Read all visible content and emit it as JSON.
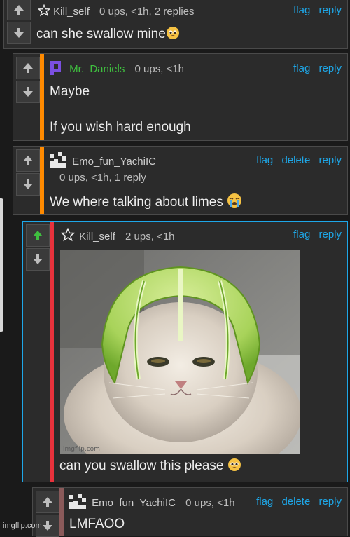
{
  "comments": [
    {
      "user": "Kill_self",
      "meta": "0 ups, <1h, 2 replies",
      "actions": [
        "flag",
        "reply"
      ],
      "text": "can she swallow mine"
    },
    {
      "user": "Mr._Daniels",
      "meta": "0 ups, <1h",
      "actions": [
        "flag",
        "reply"
      ],
      "text_lines": [
        "Maybe",
        "If you wish hard enough"
      ]
    },
    {
      "user": "Emo_fun_YachiIC",
      "meta": "0 ups, <1h, 1 reply",
      "actions": [
        "flag",
        "delete",
        "reply"
      ],
      "text": "We where talking about limes"
    },
    {
      "user": "Kill_self",
      "meta": "2 ups, <1h",
      "actions": [
        "flag",
        "reply"
      ],
      "image_watermark": "imgflip.com",
      "text": "can you swallow this please"
    },
    {
      "user": "Emo_fun_YachiIC",
      "meta": "0 ups, <1h",
      "actions": [
        "flag",
        "delete",
        "reply"
      ],
      "text": "LMFAOO"
    }
  ],
  "footer": "imgflip.com",
  "icons": {
    "upvote": "arrow-up-icon",
    "downvote": "arrow-down-icon",
    "star": "star-icon",
    "pleading": "pleading-face-emoji",
    "crying": "crying-face-emoji"
  },
  "colors": {
    "link": "#1ea7e8",
    "bar_orange": "#ff8a00",
    "bar_red": "#e8323c",
    "bar_brown": "#8a5a5a",
    "upvote_active": "#3fbf3f"
  }
}
